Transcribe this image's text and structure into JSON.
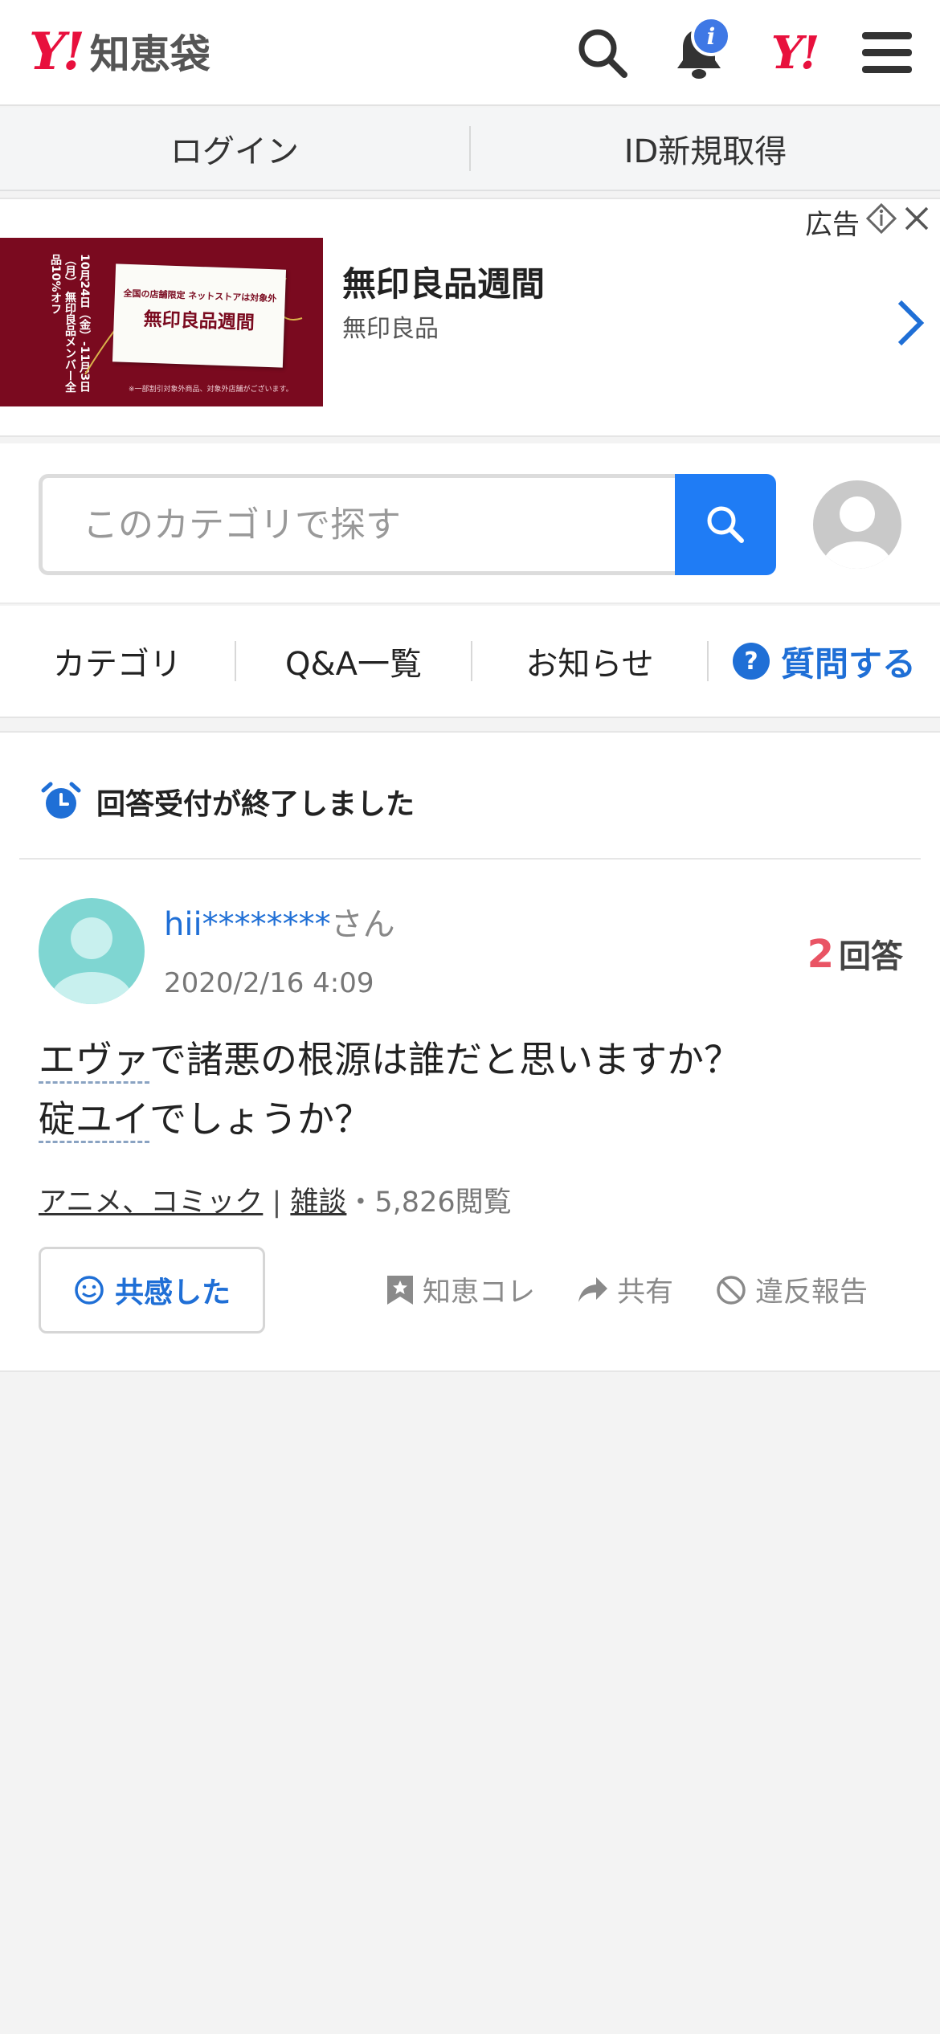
{
  "header": {
    "logo_mark": "Y!",
    "logo_text": "知恵袋",
    "notification_badge": "i",
    "yahoo_mark": "Y!"
  },
  "login_bar": {
    "login": "ログイン",
    "register": "ID新規取得"
  },
  "ad": {
    "label": "広告",
    "title": "無印良品週間",
    "advertiser": "無印良品",
    "image_vertical_text": "10月24日（金）-11月3日（月） 無印良品メンバー全品10%オフ",
    "image_sub": "全国の店舗限定 ネットストアは対象外",
    "image_main": "無印良品週間",
    "image_footnote": "※一部割引対象外商品、対象外店舗がございます。"
  },
  "search": {
    "placeholder": "このカテゴリで探す"
  },
  "nav": {
    "category": "カテゴリ",
    "qa_list": "Q&A一覧",
    "notices": "お知らせ",
    "ask_icon": "?",
    "ask": "質問する"
  },
  "question": {
    "status": "回答受付が終了しました",
    "user_id": "hii********",
    "user_suffix": "さん",
    "date": "2020/2/16 4:09",
    "answer_count": "2",
    "answer_label": "回答",
    "line1_marked": "エヴァ",
    "line1_rest": "で諸悪の根源は誰だと思いますか？",
    "line2_marked": "碇ユイ",
    "line2_rest": "でしょうか？",
    "category1": "アニメ、コミック",
    "category_sep": "|",
    "category2": "雑談",
    "views": "・5,826閲覧",
    "empathy": "共感した",
    "bookmark": "知恵コレ",
    "share": "共有",
    "report": "違反報告"
  },
  "colors": {
    "brand_red": "#e8103d",
    "link_blue": "#1f6fd6",
    "search_blue": "#1f7cf5",
    "answer_count_red": "#e95464",
    "badge_blue": "#3f78e5"
  }
}
